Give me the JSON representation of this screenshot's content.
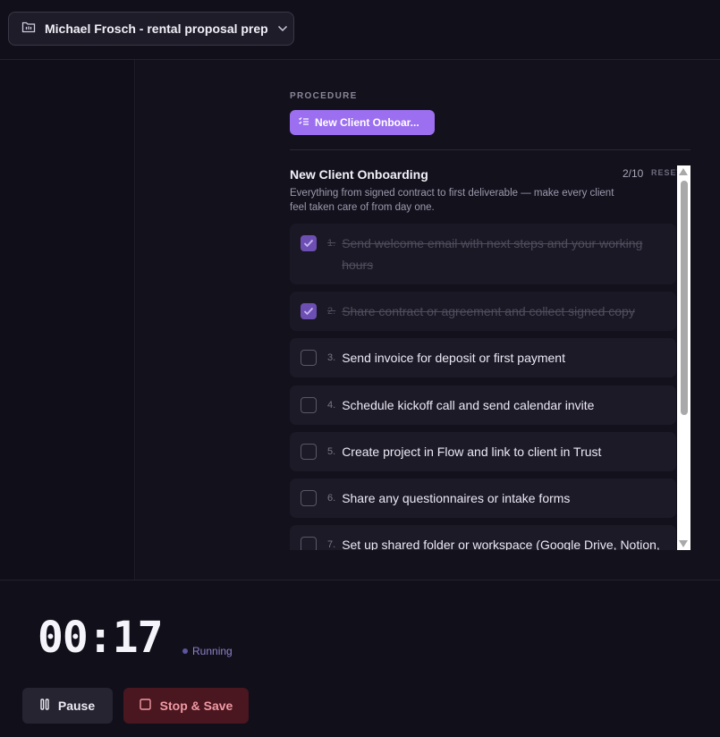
{
  "header": {
    "project_title": "Michael Frosch - rental proposal prep"
  },
  "procedure": {
    "section_label": "PROCEDURE",
    "selected_label": "New Client Onboar...",
    "accent_color": "#9b6ff0"
  },
  "checklist": {
    "title": "New Client Onboarding",
    "progress": "2/10",
    "reset_label": "RESET",
    "description": "Everything from signed contract to first deliverable — make every client feel taken care of from day one.",
    "items": [
      {
        "num": "1.",
        "text": "Send welcome email with next steps and your working hours",
        "done": true
      },
      {
        "num": "2.",
        "text": "Share contract or agreement and collect signed copy",
        "done": true
      },
      {
        "num": "3.",
        "text": "Send invoice for deposit or first payment",
        "done": false
      },
      {
        "num": "4.",
        "text": "Schedule kickoff call and send calendar invite",
        "done": false
      },
      {
        "num": "5.",
        "text": "Create project in Flow and link to client in Trust",
        "done": false
      },
      {
        "num": "6.",
        "text": "Share any questionnaires or intake forms",
        "done": false
      },
      {
        "num": "7.",
        "text": "Set up shared folder or workspace (Google Drive, Notion,",
        "done": false
      }
    ]
  },
  "timer": {
    "display": "00:17",
    "status": "Running"
  },
  "controls": {
    "pause_label": "Pause",
    "stop_label": "Stop & Save"
  }
}
